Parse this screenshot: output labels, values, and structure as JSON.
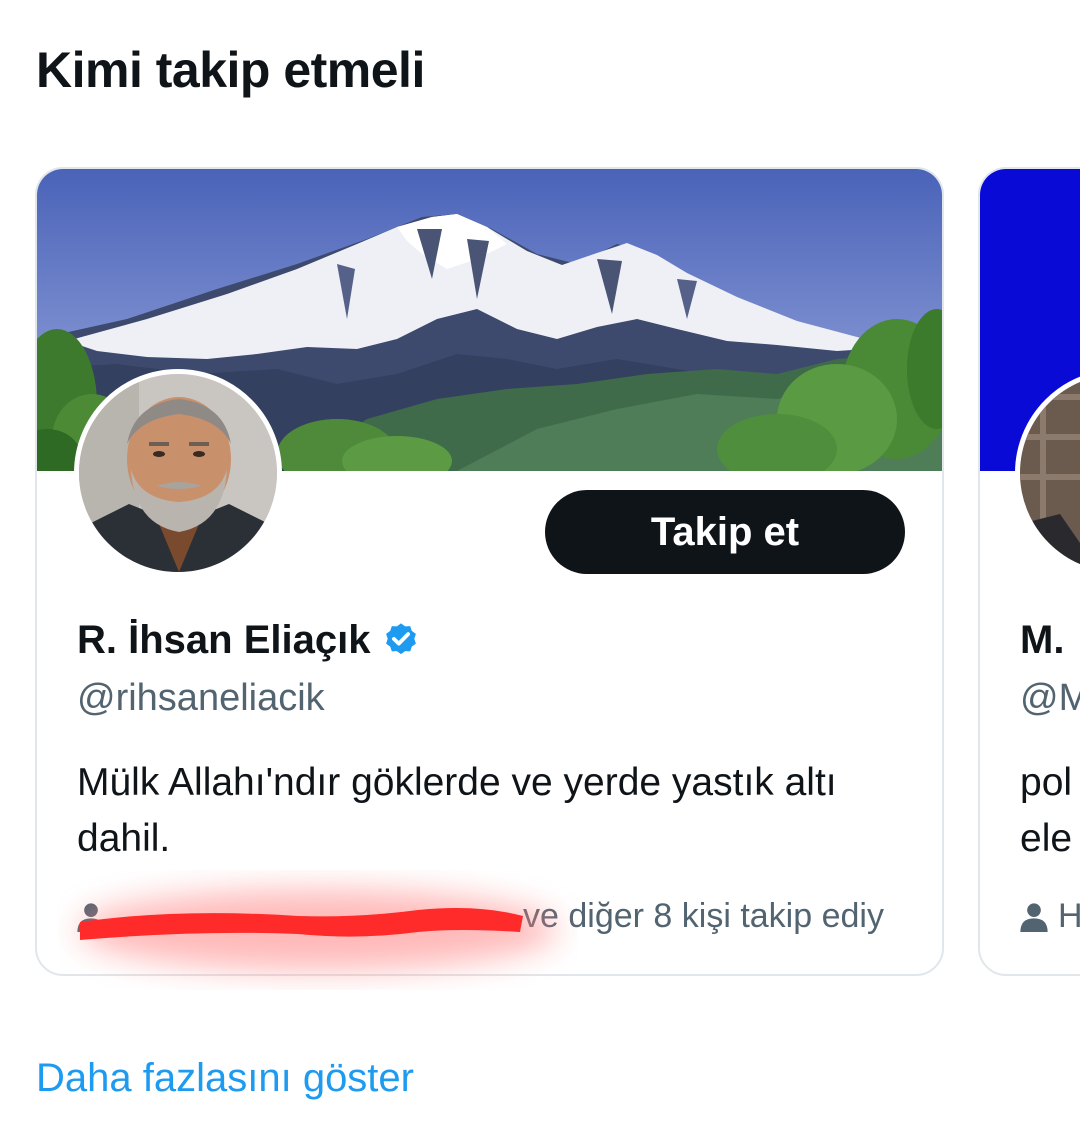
{
  "section": {
    "title": "Kimi takip etmeli",
    "show_more": "Daha fazlasını göster"
  },
  "cards": [
    {
      "name": "R. İhsan Eliaçık",
      "verified": true,
      "handle": "@rihsaneliacik",
      "bio": "Mülk Allahı'ndır göklerde ve yerde yastık altı dahil.",
      "follow_label": "Takip et",
      "social_context": "ve diğer 8 kişi takip ediy"
    },
    {
      "name": "M.",
      "handle": "@M",
      "bio": "pol ele",
      "social_context": "H"
    }
  ],
  "colors": {
    "accent": "#1d9bf0",
    "button_bg": "#0f1419",
    "secondary_text": "#536471",
    "card_border": "#e1e6ea",
    "second_banner": "#0a0ad6",
    "redaction": "#ff2a2a"
  }
}
